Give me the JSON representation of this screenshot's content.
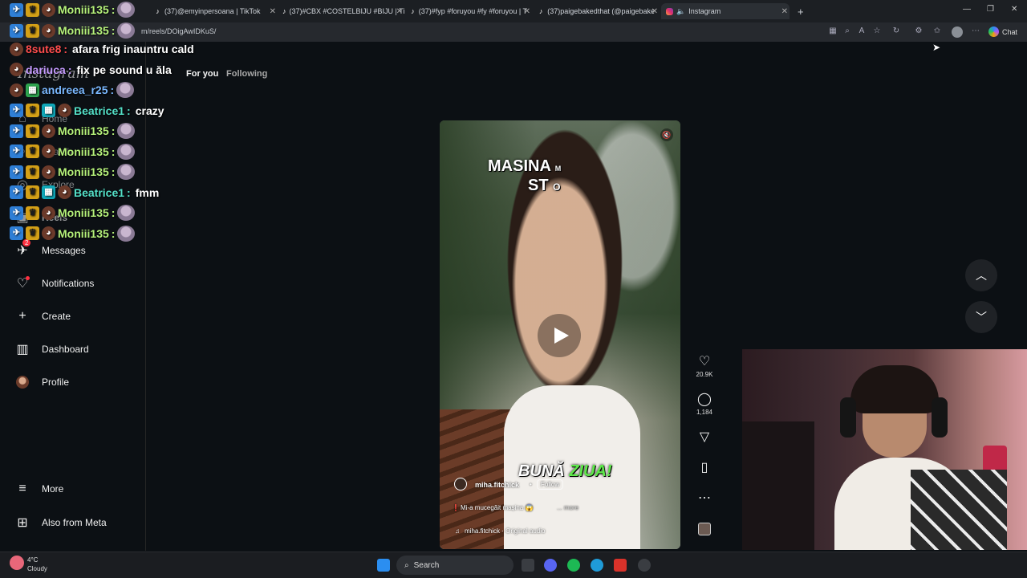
{
  "browser": {
    "tabs": [
      {
        "label": "",
        "active": false
      },
      {
        "label": "(37)@emyinpersoana | TikTok",
        "active": false
      },
      {
        "label": "(37)#CBX #COSTELBIJU #BIJU | Tik",
        "active": false
      },
      {
        "label": "(37)#fyp #foruyou #fy #foruyou | T",
        "active": false
      },
      {
        "label": "(37)paigebakedthat (@paigebake",
        "active": false
      },
      {
        "label": "Instagram",
        "active": true
      }
    ],
    "new_tab_label": "+",
    "url": "m/reels/DOigAwIDKuS/",
    "chat_button": "Chat"
  },
  "instagram": {
    "logo": "Instagram",
    "feed_tabs": [
      "For you",
      "Following"
    ],
    "nav": {
      "home": "Home",
      "search": "Search",
      "explore": "Explore",
      "reels": "Reels",
      "messages": "Messages",
      "notifications": "Notifications",
      "create": "Create",
      "dashboard": "Dashboard",
      "profile": "Profile",
      "more": "More",
      "also_from_meta": "Also from Meta"
    },
    "messages_badge": "2",
    "reel": {
      "overlay_top_line1": "MASINA",
      "overlay_top_small": "M",
      "overlay_top_line2": "ST",
      "overlay_top_small2": "O",
      "overlay_bottom_1": "BUNĂ",
      "overlay_bottom_2": "ZIUA!",
      "author": "miha.fitchick",
      "follow": "Follow",
      "caption": "Mi-a mucegăit mașina 😱",
      "caption_more": "... more",
      "audio": "miha.fitchick · Original audio"
    },
    "actions": {
      "likes": "20.9K",
      "comments": "1,184"
    }
  },
  "chat": [
    {
      "user": "8sute8",
      "color": "#ff4d4d",
      "message": "afara frig inauntru cald",
      "badges": [
        "pup"
      ],
      "emote": false
    },
    {
      "user": "dariuca",
      "color": "#c59bff",
      "message": "fix pe sound u ăla",
      "badges": [
        "pup"
      ],
      "emote": false
    },
    {
      "user": "andreea_r25",
      "color": "#7ab8ff",
      "message": "",
      "badges": [
        "pup",
        "green"
      ],
      "emote": true
    },
    {
      "user": "Beatrice1",
      "color": "#54e0c8",
      "message": "crazy",
      "badges": [
        "blue",
        "gold",
        "teal",
        "pup"
      ],
      "emote": false
    },
    {
      "user": "Moniii135",
      "color": "#b6f27a",
      "message": "",
      "badges": [
        "blue",
        "gold",
        "pup"
      ],
      "emote": true
    },
    {
      "user": "Moniii135",
      "color": "#b6f27a",
      "message": "",
      "badges": [
        "blue",
        "gold",
        "pup"
      ],
      "emote": true
    },
    {
      "user": "Moniii135",
      "color": "#b6f27a",
      "message": "",
      "badges": [
        "blue",
        "gold",
        "pup"
      ],
      "emote": true
    },
    {
      "user": "Beatrice1",
      "color": "#54e0c8",
      "message": "fmm",
      "badges": [
        "blue",
        "gold",
        "teal",
        "pup"
      ],
      "emote": false
    },
    {
      "user": "Moniii135",
      "color": "#b6f27a",
      "message": "",
      "badges": [
        "blue",
        "gold",
        "pup"
      ],
      "emote": true
    },
    {
      "user": "Moniii135",
      "color": "#b6f27a",
      "message": "",
      "badges": [
        "blue",
        "gold",
        "pup"
      ],
      "emote": true
    }
  ],
  "chat_top": [
    {
      "user": "Moniii135",
      "color": "#b6f27a"
    },
    {
      "user": "Moniii135",
      "color": "#b6f27a"
    }
  ],
  "taskbar": {
    "weather_temp": "4°C",
    "weather_desc": "Cloudy",
    "search": "Search"
  }
}
